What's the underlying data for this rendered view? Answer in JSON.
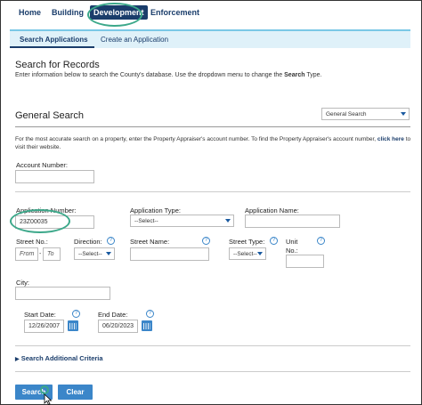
{
  "topnav": {
    "items": [
      {
        "label": "Home"
      },
      {
        "label": "Building"
      },
      {
        "label": "Development"
      },
      {
        "label": "Enforcement"
      }
    ]
  },
  "subnav": {
    "items": [
      {
        "label": "Search Applications"
      },
      {
        "label": "Create an Application"
      }
    ]
  },
  "header": {
    "title": "Search for Records",
    "desc_pre": "Enter information below to search the County's database. Use the dropdown menu to change the ",
    "desc_bold": "Search",
    "desc_post": " Type."
  },
  "general": {
    "title": "General Search",
    "search_type": "General Search",
    "note_pre": "For the most accurate search on a property, enter the Property Appraiser's account number. To find the Property Appraiser's account number, ",
    "note_link": "click here",
    "note_post": " to visit their website."
  },
  "fields": {
    "account_number_label": "Account Number:",
    "account_number_value": "",
    "application_number_label": "Application Number:",
    "application_number_value": "23Z00035",
    "application_type_label": "Application Type:",
    "application_type_value": "--Select--",
    "application_name_label": "Application Name:",
    "street_no_label": "Street No.:",
    "street_from_placeholder": "From",
    "street_dash": "-",
    "street_to_placeholder": "To",
    "direction_label": "Direction:",
    "direction_value": "--Select--",
    "street_name_label": "Street Name:",
    "street_type_label": "Street Type:",
    "street_type_value": "--Select--",
    "unit_no_label": "Unit No.:",
    "city_label": "City:",
    "start_date_label": "Start Date:",
    "start_date_value": "12/26/2007",
    "end_date_label": "End Date:",
    "end_date_value": "06/20/2023",
    "help_glyph": "?"
  },
  "additional": {
    "label": "Search Additional Criteria"
  },
  "buttons": {
    "search": "Search",
    "clear": "Clear"
  },
  "colors": {
    "brand": "#1a3d6b",
    "accent": "#3b86c9",
    "highlight_oval": "#3ca88a",
    "subnav_bg": "#dff1f9"
  }
}
